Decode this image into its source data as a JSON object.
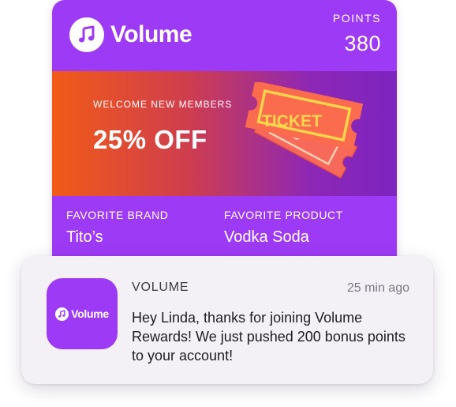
{
  "card": {
    "brand_name": "Volume",
    "brand_icon": "music-note-icon",
    "points_label": "POINTS",
    "points_value": "380",
    "promo": {
      "kicker": "WELCOME NEW MEMBERS",
      "headline": "25% OFF",
      "ticket_text": "TICKET",
      "ticket_back_text": "TIC"
    },
    "favorite_brand_label": "FAVORITE BRAND",
    "favorite_brand_value": "Tito’s",
    "favorite_product_label": "FAVORITE PRODUCT",
    "favorite_product_value": "Vodka Soda"
  },
  "notification": {
    "app_icon_text": "Volume",
    "app_name": "VOLUME",
    "time": "25 min ago",
    "message": "Hey Linda, thanks for joining Volume Rewards! We just pushed 200 bonus points to your account!"
  },
  "colors": {
    "brand_purple": "#9d3af5",
    "promo_orange": "#f25b17",
    "promo_purple": "#7d24c0",
    "ticket_orange": "#fb6b4e",
    "ticket_yellow": "#ffd64a"
  }
}
